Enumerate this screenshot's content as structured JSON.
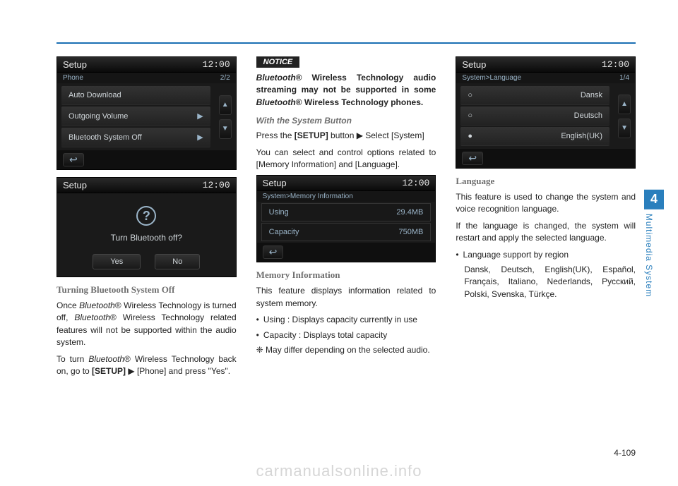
{
  "page": {
    "number": "4-109",
    "chapter_number": "4",
    "chapter_label": "Multimedia System",
    "watermark": "carmanualsonline.info"
  },
  "col1": {
    "screen1": {
      "title": "Setup",
      "time": "12:00",
      "breadcrumb": "Phone",
      "page_indicator": "2/2",
      "rows": [
        "Auto Download",
        "Outgoing Volume",
        "Bluetooth System Off"
      ]
    },
    "screen2": {
      "title": "Setup",
      "time": "12:00",
      "dialog_text": "Turn Bluetooth off?",
      "yes": "Yes",
      "no": "No"
    },
    "heading": "Turning Bluetooth System Off",
    "p1a": "Once ",
    "p1b": "Bluetooth",
    "p1c": "® Wireless Technology is turned off, ",
    "p1d": "Bluetooth",
    "p1e": "® Wireless Technology related features will not be supported within the audio system.",
    "p2a": "To turn ",
    "p2b": "Bluetooth",
    "p2c": "® Wireless Technology back on, go to ",
    "p2d": "[SETUP]",
    "p2e": " ▶ [Phone] and press \"Yes\"."
  },
  "col2": {
    "notice_label": "NOTICE",
    "notice_a": "Bluetooth",
    "notice_b": "® Wireless Technology audio streaming may not be supported in some ",
    "notice_c": "Bluetooth",
    "notice_d": "® Wireless Technology phones.",
    "subheading": "With the System Button",
    "p1a": "Press the ",
    "p1b": "[SETUP]",
    "p1c": " button ▶ Select [System]",
    "p2": "You can select and control options related to [Memory Information] and [Language].",
    "screen": {
      "title": "Setup",
      "time": "12:00",
      "breadcrumb": "System>Memory Information",
      "using_label": "Using",
      "using_value": "29.4MB",
      "capacity_label": "Capacity",
      "capacity_value": "750MB"
    },
    "heading2": "Memory Information",
    "p3": "This feature displays information related to system memory.",
    "b1": "Using : Displays capacity currently in use",
    "b2": "Capacity : Displays total capacity",
    "note": "❈ May differ depending on the selected audio."
  },
  "col3": {
    "screen": {
      "title": "Setup",
      "time": "12:00",
      "breadcrumb": "System>Language",
      "page_indicator": "1/4",
      "rows": [
        "Dansk",
        "Deutsch",
        "English(UK)"
      ]
    },
    "heading": "Language",
    "p1": "This feature is used to change the system and voice recognition language.",
    "p2": "If the language is changed, the system will restart and apply the selected language.",
    "b1": "Language support by region",
    "langs": "Dansk, Deutsch, English(UK), Español, Français, Italiano, Nederlands, Русский, Polski, Svenska, Türkçe."
  }
}
